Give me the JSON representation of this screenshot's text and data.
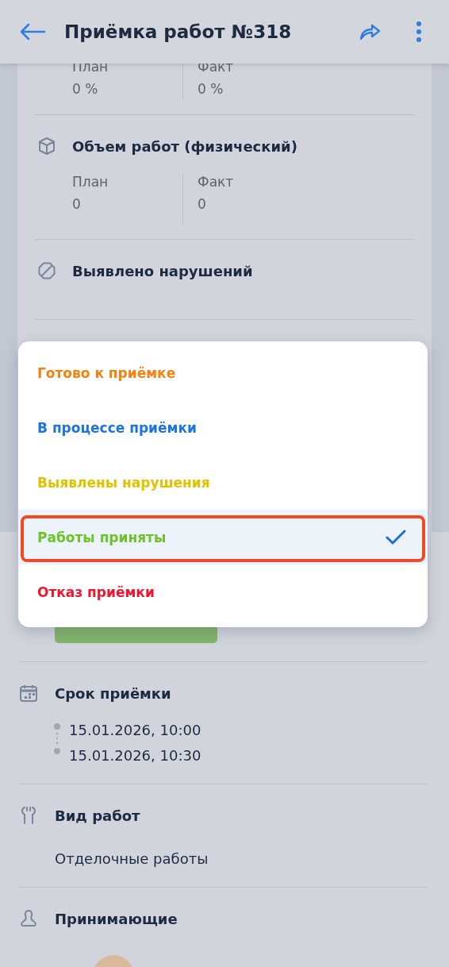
{
  "header": {
    "title": "Приёмка работ №318"
  },
  "top_metrics": {
    "plan_label": "План",
    "plan_value": "0 %",
    "fact_label": "Факт",
    "fact_value": "0 %"
  },
  "volume": {
    "title": "Объем работ (физический)",
    "plan_label": "План",
    "plan_value": "0",
    "fact_label": "Факт",
    "fact_value": "0"
  },
  "violations": {
    "title": "Выявлено нарушений"
  },
  "deadline": {
    "title": "Срок приёмки",
    "start": "15.01.2026, 10:00",
    "end": "15.01.2026, 10:30"
  },
  "work_type": {
    "title": "Вид работ",
    "value": "Отделочные работы"
  },
  "acceptors": {
    "title": "Принимающие"
  },
  "status_menu": [
    {
      "label": "Готово к приёмке",
      "color": "#f5820f",
      "selected": false
    },
    {
      "label": "В процессе приёмки",
      "color": "#1a73e8",
      "selected": false
    },
    {
      "label": "Выявлены нарушения",
      "color": "#e0c200",
      "selected": false
    },
    {
      "label": "Работы приняты",
      "color": "#6cc425",
      "selected": true
    },
    {
      "label": "Отказ приёмки",
      "color": "#f0142f",
      "selected": false
    }
  ]
}
